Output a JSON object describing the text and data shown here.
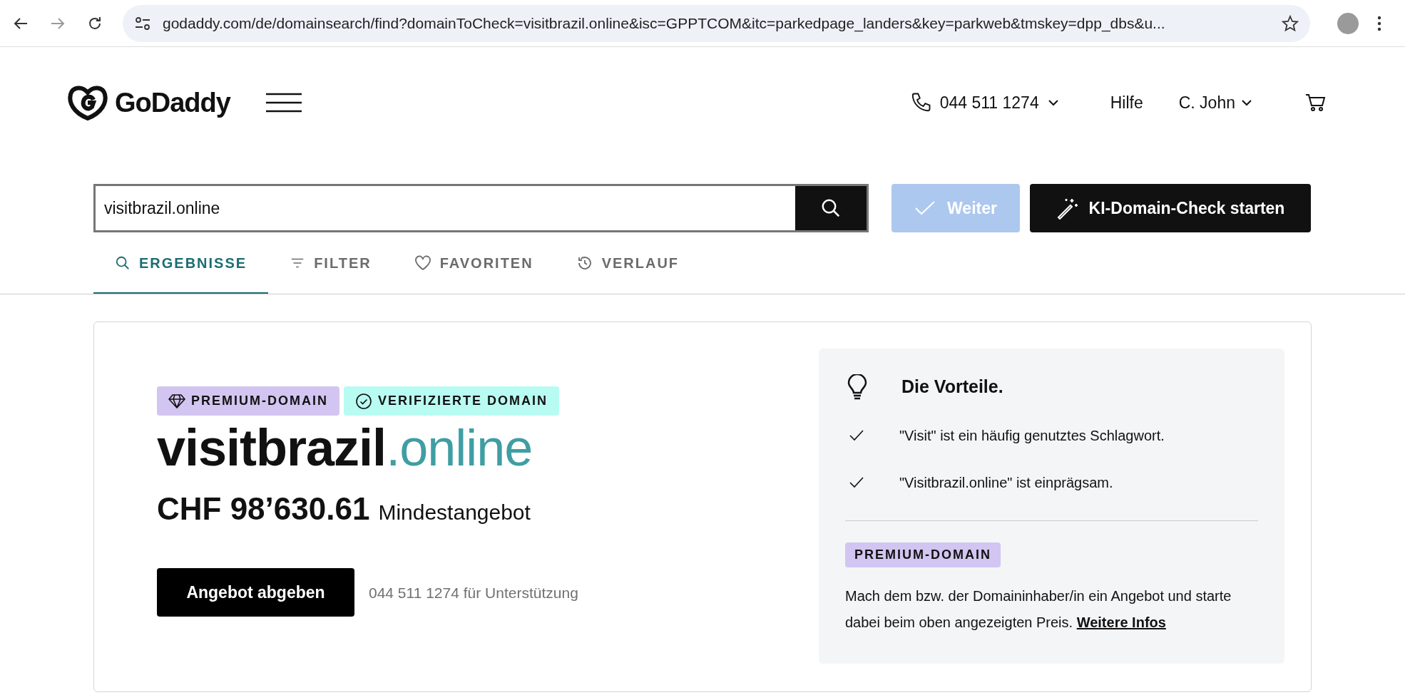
{
  "browser": {
    "url": "godaddy.com/de/domainsearch/find?domainToCheck=visitbrazil.online&isc=GPPTCOM&itc=parkedpage_landers&key=parkweb&tmskey=dpp_dbs&u..."
  },
  "header": {
    "logo": "GoDaddy",
    "phone": "044 511 1274",
    "help": "Hilfe",
    "user": "C. John"
  },
  "search": {
    "value": "visitbrazil.online",
    "continue_button": {
      "label": "Weiter",
      "disabled": true
    },
    "ai_button": "KI-Domain-Check starten"
  },
  "tabs": [
    {
      "label": "ERGEBNISSE",
      "selected": true
    },
    {
      "label": "FILTER",
      "selected": false
    },
    {
      "label": "FAVORITEN",
      "selected": false
    },
    {
      "label": "VERLAUF",
      "selected": false
    }
  ],
  "result": {
    "badges": [
      {
        "label": "PREMIUM-DOMAIN",
        "kind": "premium"
      },
      {
        "label": "VERIFIZIERTE DOMAIN",
        "kind": "verified"
      }
    ],
    "domain_name": "visitbrazil",
    "domain_tld": ".online",
    "price": "CHF 98’630.61",
    "price_note": "Mindestangebot",
    "offer_button": "Angebot abgeben",
    "support_text": "044 511 1274 für Unterstützung"
  },
  "benefits": {
    "title": "Die Vorteile.",
    "items": [
      "\"Visit\" ist ein häufig genutztes Schlagwort.",
      "\"Visitbrazil.online\" ist einprägsam."
    ],
    "badge": "PREMIUM-DOMAIN",
    "text": "Mach dem bzw. der Domaininhaber/in ein Angebot und starte dabei beim oben angezeigten Preis.",
    "link": "Weitere Infos"
  }
}
